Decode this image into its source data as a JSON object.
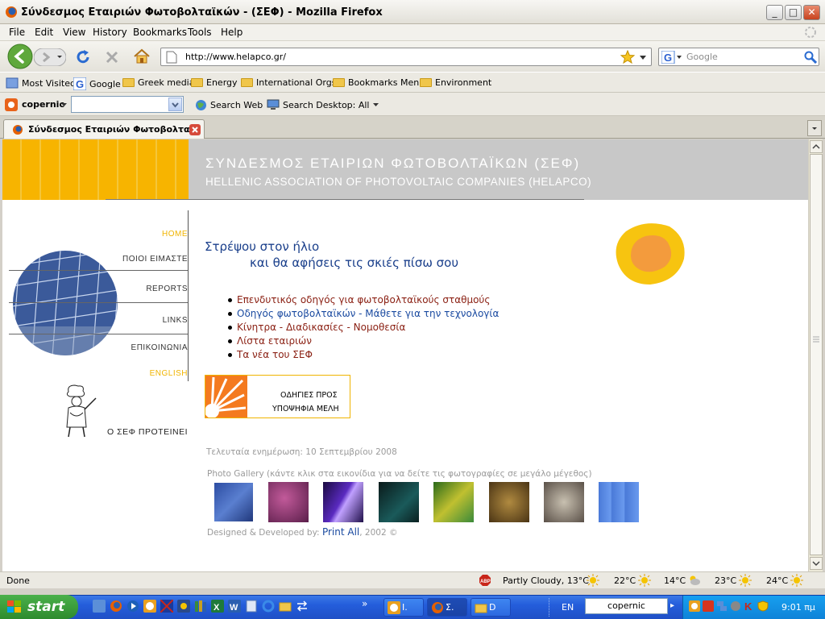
{
  "window": {
    "title": "Σύνδεσμος Εταιριών Φωτοβολταϊκών - (ΣΕΦ) - Mozilla Firefox"
  },
  "menu": [
    "File",
    "Edit",
    "View",
    "History",
    "Bookmarks",
    "Tools",
    "Help"
  ],
  "nav": {
    "url": "http://www.helapco.gr/",
    "search_placeholder": "Google"
  },
  "bookmarks": [
    "Most Visited",
    "Google",
    "Greek media",
    "Energy",
    "International Orgs",
    "Bookmarks Menu",
    "Environment"
  ],
  "copernic_bar": {
    "brand": "copernic",
    "search_web": "Search Web",
    "search_desktop": "Search Desktop: All"
  },
  "tab": {
    "title": "Σύνδεσμος Εταιριών Φωτοβολταϊ..."
  },
  "site": {
    "header_greek": "ΣΥΝΔΕΣΜΟΣ ΕΤΑΙΡΙΩΝ ΦΩΤΟΒΟΛΤΑΪΚΩΝ (ΣΕΦ)",
    "header_english": "HELLENIC ASSOCIATION OF PHOTOVOLTAIC COMPANIES (HELAPCO)",
    "nav": [
      "HOME",
      "ΠΟΙΟΙ ΕΙΜΑΣΤΕ",
      "REPORTS",
      "LINKS",
      "ΕΠΙΚΟΙΝΩΝΙΑ",
      "ENGLISH"
    ],
    "recommends": "Ο ΣΕΦ ΠΡΟΤΕΙΝΕΙ",
    "slogan_line1": "Στρέψου στον ήλιο",
    "slogan_line2": "και θα αφήσεις τις σκιές πίσω σου",
    "links": [
      "Επενδυτικός οδηγός για φωτοβολταϊκούς σταθμούς",
      "Οδηγός φωτοβολταϊκών - Μάθετε για την τεχνολογία",
      "Κίνητρα - Διαδικασίες - Νομοθεσία",
      "Λίστα εταιριών",
      "Τα νέα του ΣΕΦ"
    ],
    "banner_line1": "ΟΔΗΓΙΕΣ ΠΡΟΣ",
    "banner_line2": "ΥΠΟΨΗΦΙΑ ΜΕΛΗ",
    "last_update": "Τελευταία ενημέρωση: 10 Σεπτεμβρίου 2008",
    "gallery_title": "Photo Gallery (κάντε κλικ στα εικονίδια για να δείτε τις φωτογραφίες σε μεγάλο μέγεθος)",
    "designed_prefix": "Designed & Developed by:",
    "designed_link": "Print All",
    "designed_suffix": ", 2002 ©"
  },
  "status": {
    "text": "Done",
    "weather_main": "Partly Cloudy, 13°C",
    "temps": [
      "22°C",
      "14°C",
      "23°C",
      "24°C"
    ]
  },
  "taskbar": {
    "start": "start",
    "buttons": [
      "I.",
      "Σ.",
      "D"
    ],
    "lang": "EN",
    "copernic": "copernic",
    "clock": "9:01 πμ"
  },
  "colors": {
    "link_red": "#8a1f12",
    "link_blue": "#1a4aa0",
    "slogan": "#1a3f8b",
    "nav_highlight": "#f0b400",
    "header_gray": "#c8c8c8"
  }
}
